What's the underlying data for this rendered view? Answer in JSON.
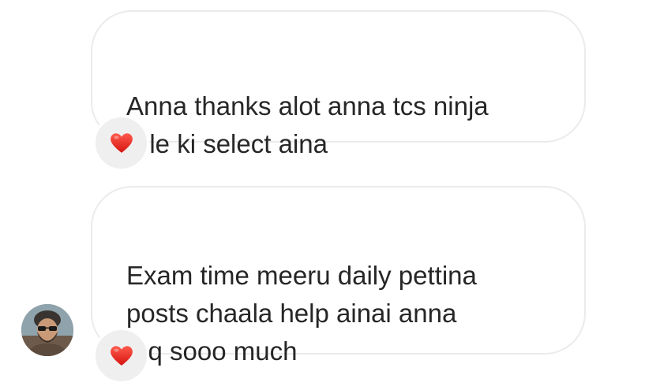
{
  "messages": [
    {
      "text": "Anna thanks alot anna tcs ninja\nrole ki select aina",
      "reaction": "red-heart-emoji"
    },
    {
      "text": "Exam time meeru daily pettina\nposts chaala help ainai anna\ntqq sooo much",
      "reaction": "red-heart-emoji"
    }
  ],
  "sender": {
    "avatar_icon": "user-avatar-photo"
  },
  "colors": {
    "bubble_border": "#ebebeb",
    "text": "#262626",
    "reaction_bg": "#efefef",
    "heart": "#e0201e"
  }
}
